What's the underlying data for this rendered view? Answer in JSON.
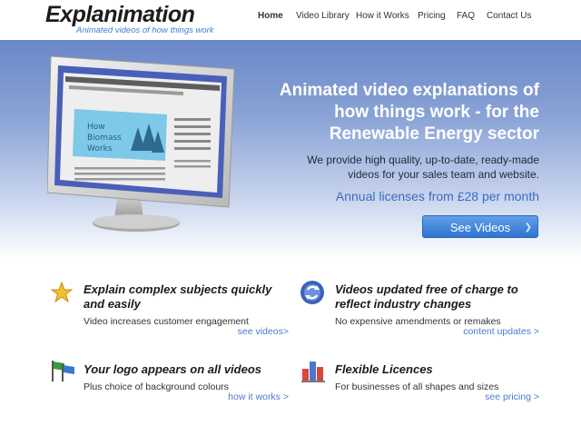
{
  "header": {
    "logo_text": "Explanimation",
    "logo_tagline": "Animated videos of how things work",
    "nav": [
      {
        "label": "Home",
        "active": true
      },
      {
        "label": "Video Library",
        "active": false
      },
      {
        "label": "How it Works",
        "active": false
      },
      {
        "label": "Pricing",
        "active": false
      },
      {
        "label": "FAQ",
        "active": false
      },
      {
        "label": "Contact Us",
        "active": false
      }
    ]
  },
  "hero": {
    "title": "Animated video explanations of how things work - for the Renewable Energy sector",
    "subtitle": "We provide high quality, up-to-date, ready-made videos for your sales team and website.",
    "price_line": "Annual licenses from £28 per month",
    "cta_label": "See Videos",
    "screen_text": "How Biomass Works"
  },
  "features": [
    {
      "title": "Explain complex subjects quickly and easily",
      "desc": "Video increases customer engagement",
      "link": "see videos>",
      "icon": "star-icon"
    },
    {
      "title": "Videos updated free of charge to reflect industry changes",
      "desc": "No expensive amendments or remakes",
      "link": "content updates >",
      "icon": "refresh-icon"
    },
    {
      "title": "Your logo appears on all videos",
      "desc": "Plus choice of background colours",
      "link": "how it works >",
      "icon": "flags-icon"
    },
    {
      "title": "Flexible Licences",
      "desc": "For businesses of all shapes and sizes",
      "link": "see pricing >",
      "icon": "bar-chart-icon"
    }
  ],
  "colors": {
    "accent": "#3a6cc4",
    "hero_top": "#6a87c8",
    "button": "#2f74cf"
  }
}
